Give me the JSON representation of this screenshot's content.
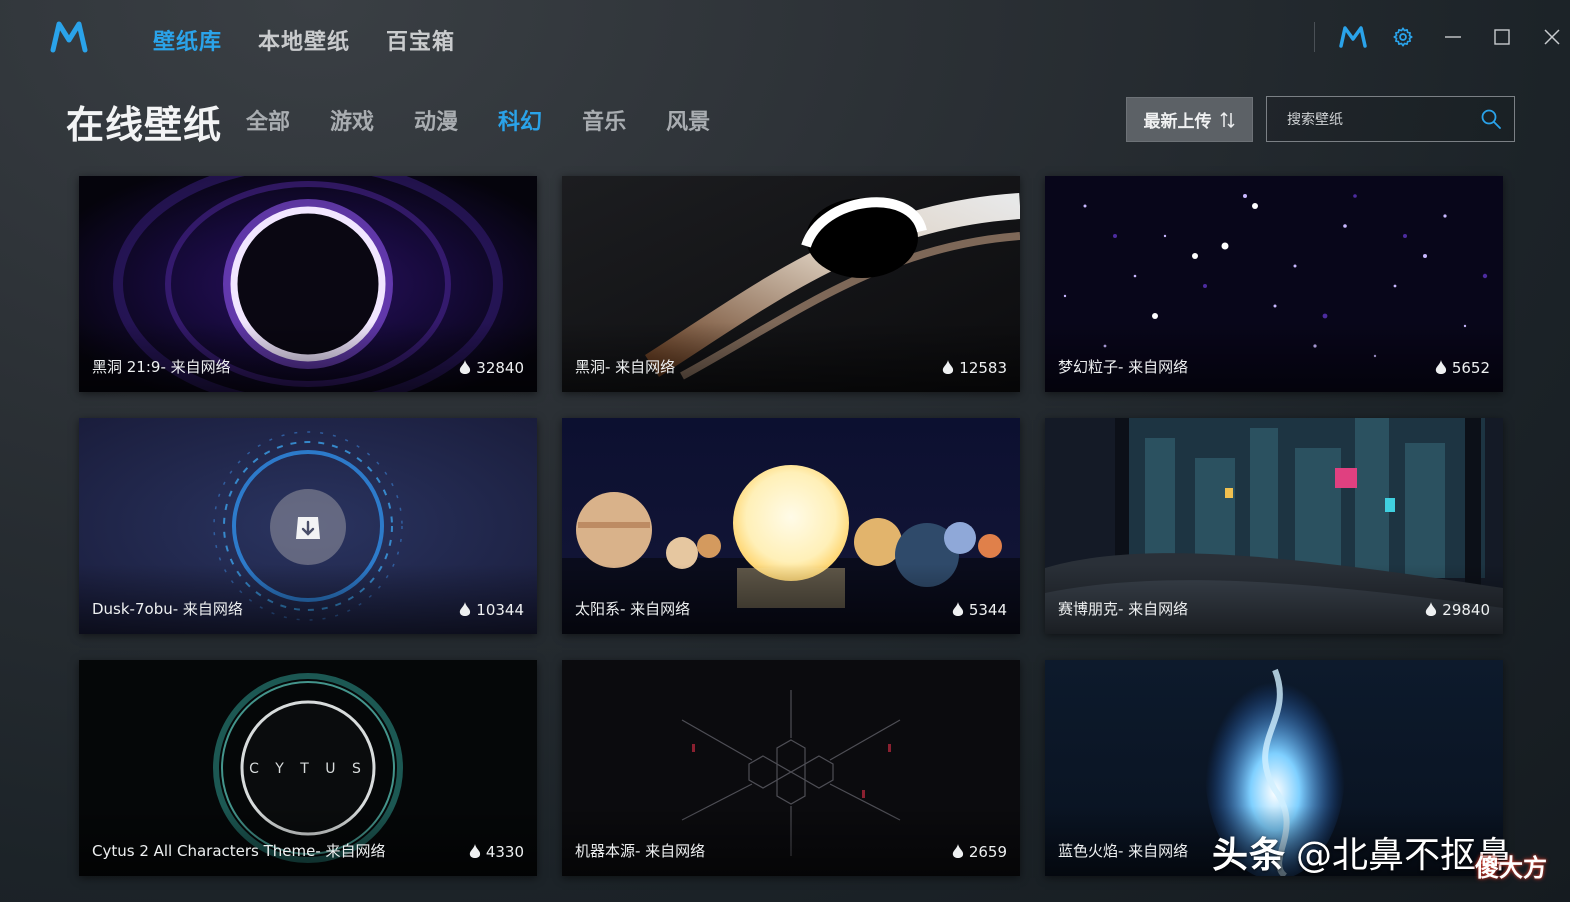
{
  "app": {
    "logo": "M",
    "accent_color": "#2aa3ea"
  },
  "nav": {
    "tabs": [
      {
        "label": "壁纸库",
        "active": true
      },
      {
        "label": "本地壁纸",
        "active": false
      },
      {
        "label": "百宝箱",
        "active": false
      }
    ]
  },
  "window_controls": {
    "icons": [
      "m-logo-icon",
      "settings-gear-icon",
      "minimize-icon",
      "maximize-icon",
      "close-icon"
    ]
  },
  "header": {
    "title": "在线壁纸",
    "categories": [
      {
        "label": "全部",
        "active": false
      },
      {
        "label": "游戏",
        "active": false
      },
      {
        "label": "动漫",
        "active": false
      },
      {
        "label": "科幻",
        "active": true
      },
      {
        "label": "音乐",
        "active": false
      },
      {
        "label": "风景",
        "active": false
      }
    ],
    "sort_label": "最新上传",
    "sort_icon": "sort-arrows-icon",
    "search": {
      "placeholder": "搜索壁纸",
      "value": ""
    }
  },
  "wallpapers": [
    {
      "title": "黑洞 21:9- 来自网络",
      "heat": "32840"
    },
    {
      "title": "黑洞- 来自网络",
      "heat": "12583"
    },
    {
      "title": "梦幻粒子- 来自网络",
      "heat": "5652"
    },
    {
      "title": "Dusk-7obu- 来自网络",
      "heat": "10344",
      "download_icon": "download-icon"
    },
    {
      "title": "太阳系- 来自网络",
      "heat": "5344"
    },
    {
      "title": "赛博朋克- 来自网络",
      "heat": "29840"
    },
    {
      "title": "Cytus 2 All Characters Theme- 来自网络",
      "heat": "4330",
      "thumb_text": "C Y T U S"
    },
    {
      "title": "机器本源- 来自网络",
      "heat": "2659"
    },
    {
      "title": "蓝色火焰- 来自网络",
      "heat": ""
    }
  ],
  "watermark": {
    "brand": "头条",
    "handle": "@北鼻不抠鼻",
    "badge": "傻大方"
  }
}
